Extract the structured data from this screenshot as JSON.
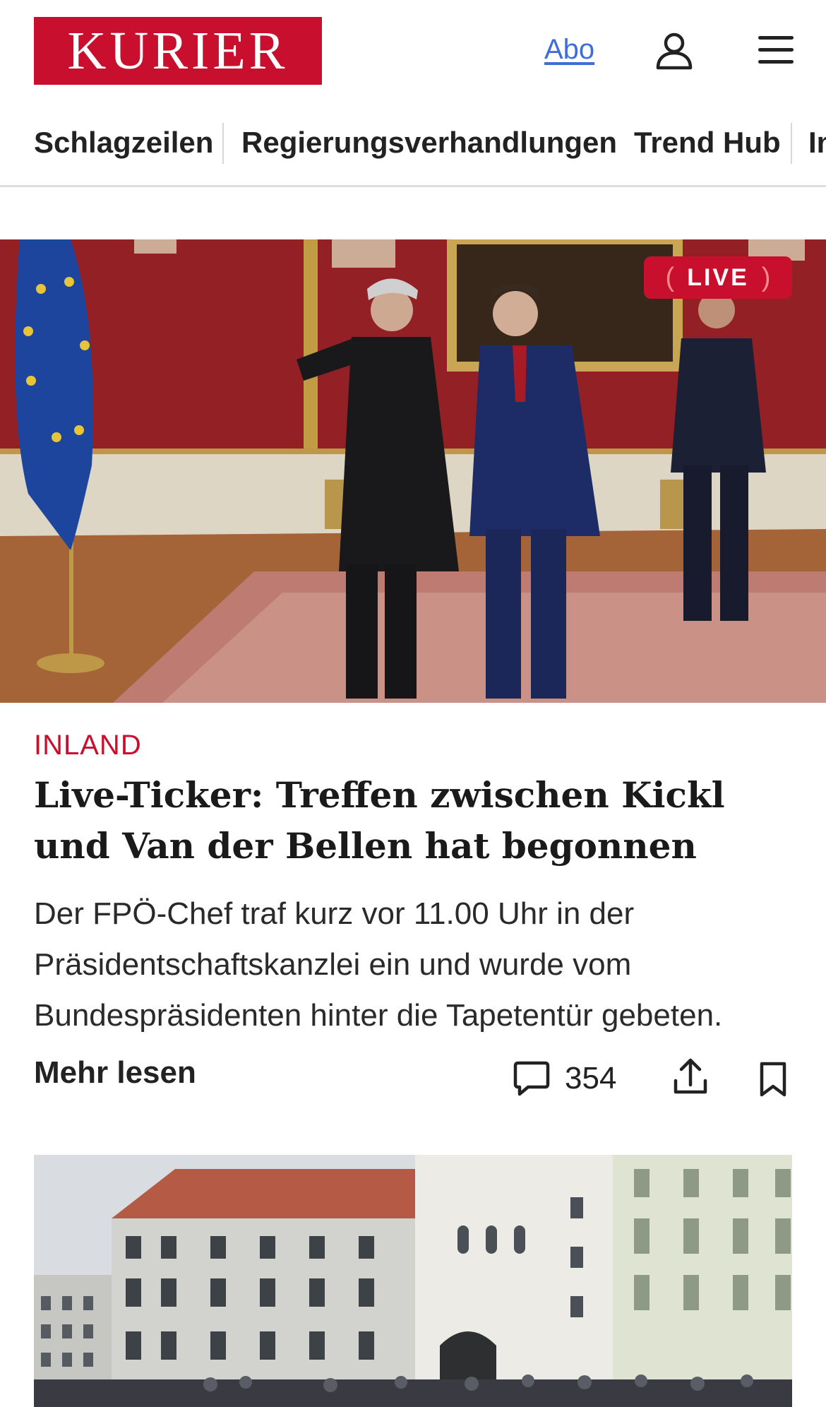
{
  "header": {
    "logo_text": "KURIER",
    "abo_label": "Abo",
    "user_icon": "user-icon",
    "menu_icon": "hamburger-menu-icon"
  },
  "category_nav": {
    "items": [
      {
        "label": "Schlagzeilen"
      },
      {
        "label": "Regierungsverhandlungen"
      },
      {
        "label": "Trend Hub"
      },
      {
        "label": "In"
      }
    ]
  },
  "lead_article": {
    "badge": "LIVE",
    "badge_paren_left": "(",
    "badge_paren_right": ")",
    "section": "INLAND",
    "headline": "Live-Ticker: Treffen zwischen Kickl und Van der Bellen hat begonnen",
    "teaser": "Der FPÖ-Chef traf kurz vor 11.00 Uhr in der Präsidentschaftskanzlei ein und wurde vom Bundespräsidenten hinter die Tapetentür gebeten.",
    "more_label": "Mehr lesen",
    "comment_count": "354",
    "comment_icon": "comment-icon",
    "share_icon": "share-icon",
    "bookmark_icon": "bookmark-icon"
  },
  "colors": {
    "brand": "#c8102e",
    "link": "#3f6ed8",
    "text": "#222222"
  }
}
